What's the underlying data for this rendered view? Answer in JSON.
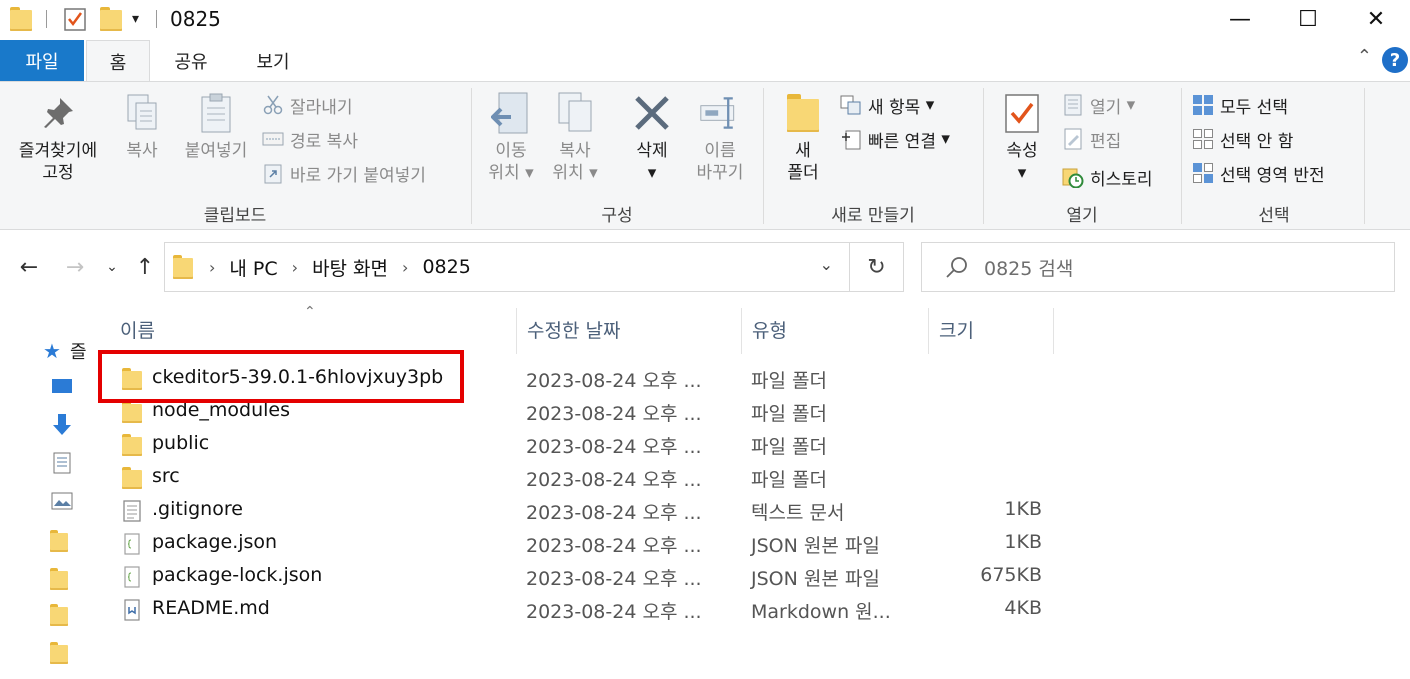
{
  "window": {
    "title": "0825"
  },
  "tabs": {
    "file": "파일",
    "home": "홈",
    "share": "공유",
    "view": "보기"
  },
  "ribbon": {
    "clipboard": {
      "label": "클립보드",
      "pin_line1": "즐겨찾기에",
      "pin_line2": "고정",
      "copy": "복사",
      "paste": "붙여넣기",
      "cut": "잘라내기",
      "copy_path": "경로 복사",
      "paste_shortcut": "바로 가기 붙여넣기"
    },
    "organize": {
      "label": "구성",
      "move_line1": "이동",
      "move_line2": "위치",
      "copyto_line1": "복사",
      "copyto_line2": "위치",
      "delete": "삭제",
      "rename_line1": "이름",
      "rename_line2": "바꾸기"
    },
    "new": {
      "label": "새로 만들기",
      "folder_line1": "새",
      "folder_line2": "폴더",
      "new_item": "새 항목",
      "easy_access": "빠른 연결"
    },
    "open": {
      "label": "열기",
      "properties": "속성",
      "open": "열기",
      "edit": "편집",
      "history": "히스토리"
    },
    "select": {
      "label": "선택",
      "select_all": "모두 선택",
      "select_none": "선택 안 함",
      "invert": "선택 영역 반전"
    }
  },
  "address": {
    "crumbs": [
      "내 PC",
      "바탕 화면",
      "0825"
    ],
    "search_placeholder": "0825 검색"
  },
  "columns": {
    "name": "이름",
    "date": "수정한 날짜",
    "type": "유형",
    "size": "크기"
  },
  "navpane": {
    "quick_access": "즐"
  },
  "files": [
    {
      "name": "ckeditor5-39.0.1-6hlovjxuy3pb",
      "date": "2023-08-24 오후 ...",
      "type": "파일 폴더",
      "size": ""
    },
    {
      "name": "node_modules",
      "date": "2023-08-24 오후 ...",
      "type": "파일 폴더",
      "size": ""
    },
    {
      "name": "public",
      "date": "2023-08-24 오후 ...",
      "type": "파일 폴더",
      "size": ""
    },
    {
      "name": "src",
      "date": "2023-08-24 오후 ...",
      "type": "파일 폴더",
      "size": ""
    },
    {
      "name": ".gitignore",
      "date": "2023-08-24 오후 ...",
      "type": "텍스트 문서",
      "size": "1KB"
    },
    {
      "name": "package.json",
      "date": "2023-08-24 오후 ...",
      "type": "JSON 원본 파일",
      "size": "1KB"
    },
    {
      "name": "package-lock.json",
      "date": "2023-08-24 오후 ...",
      "type": "JSON 원본 파일",
      "size": "675KB"
    },
    {
      "name": "README.md",
      "date": "2023-08-24 오후 ...",
      "type": "Markdown 원...",
      "size": "4KB"
    }
  ],
  "colors": {
    "accent": "#1979ca",
    "highlight": "#e40000",
    "folder": "#f8d775"
  }
}
